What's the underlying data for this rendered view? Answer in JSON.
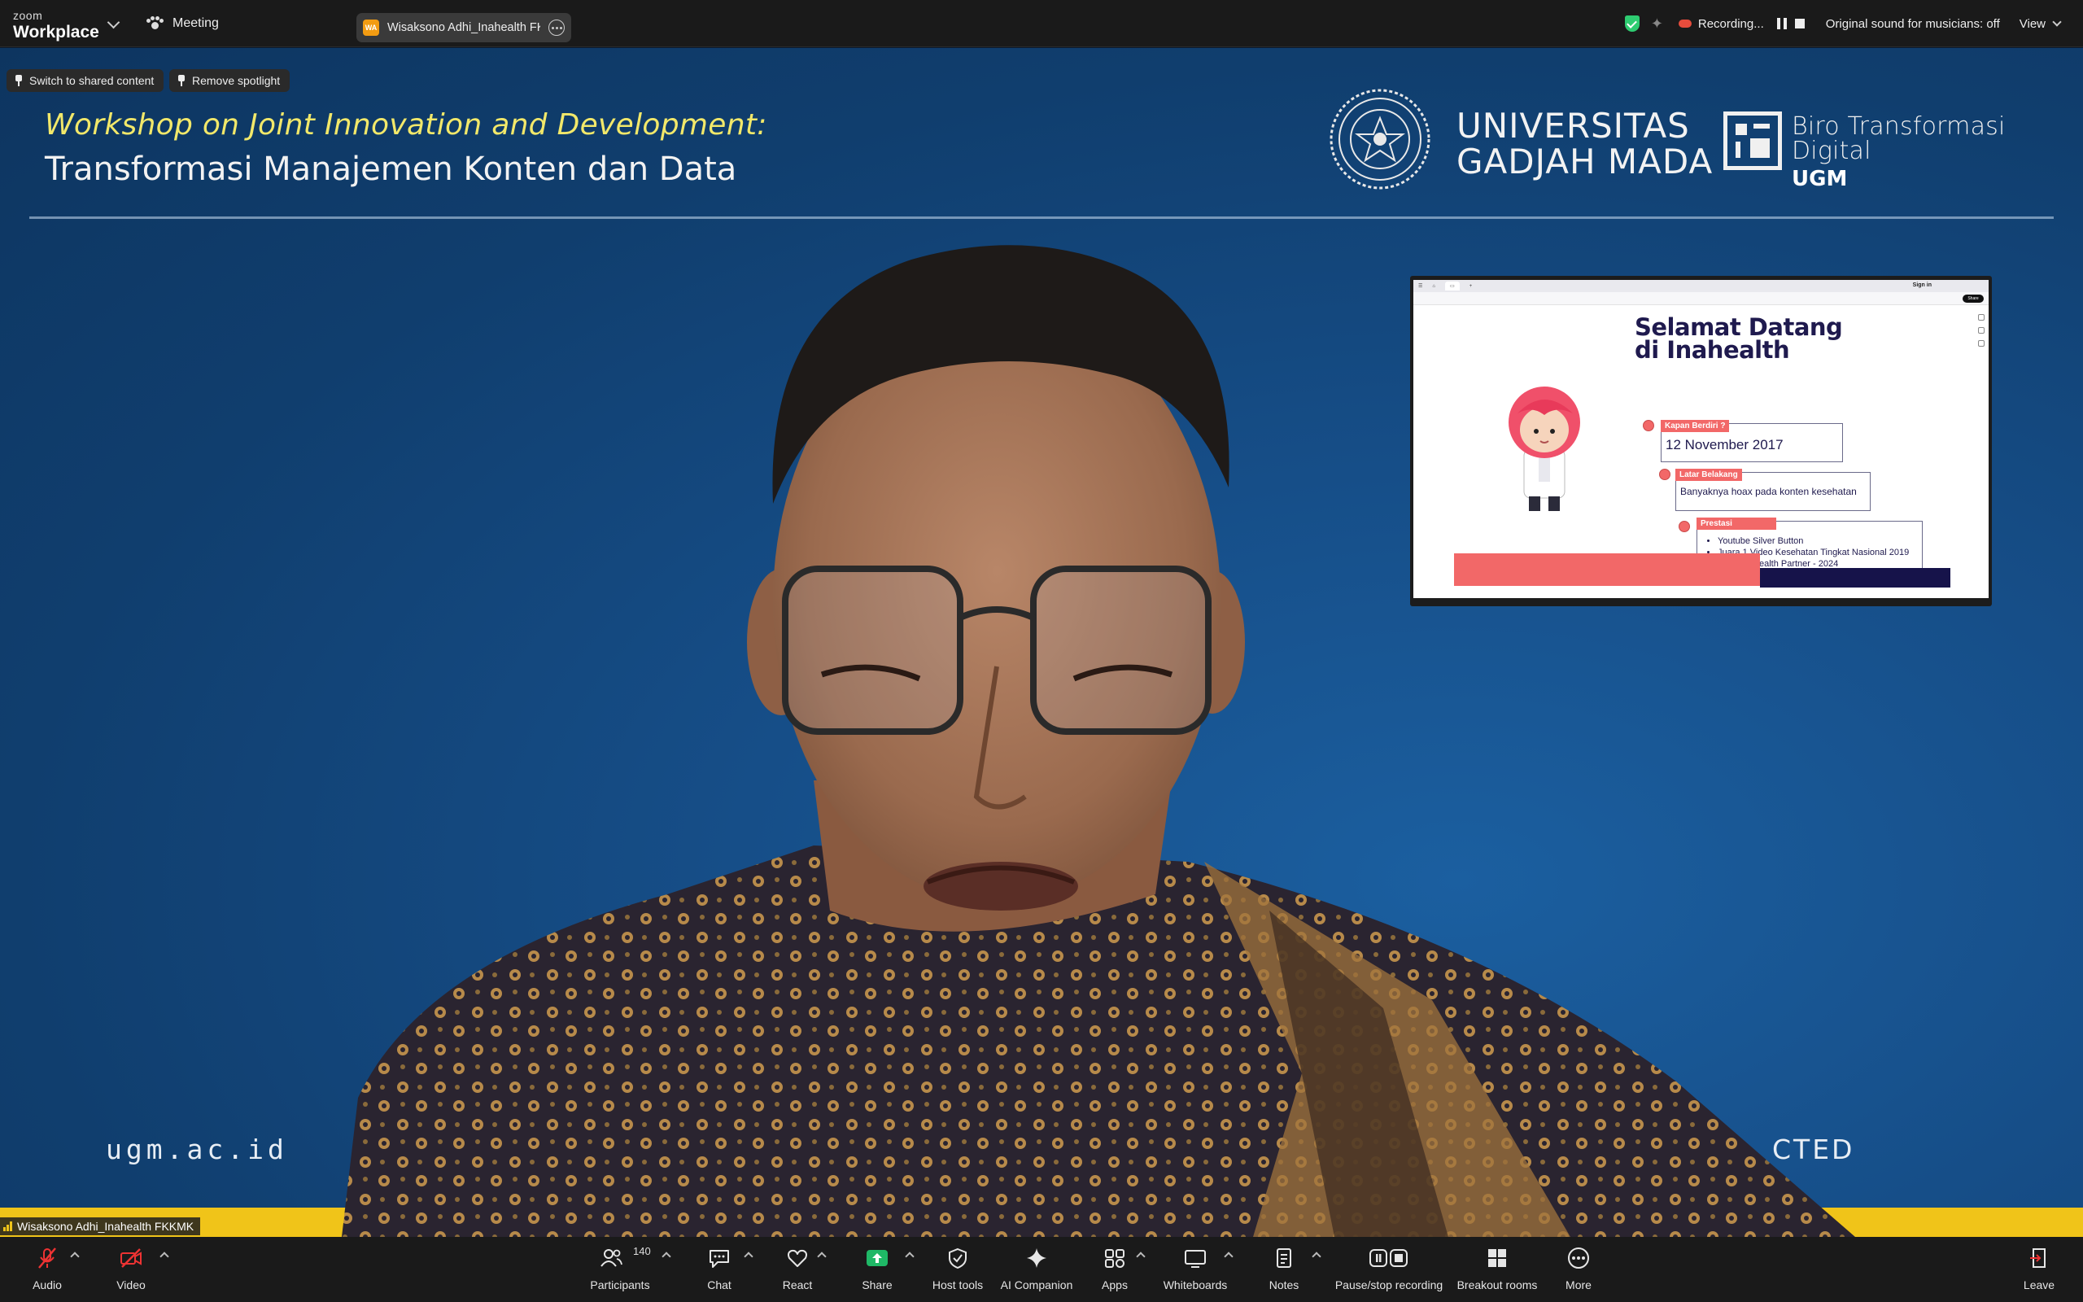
{
  "app": {
    "logo_top": "zoom",
    "logo_bottom": "Workplace",
    "meeting_label": "Meeting",
    "tab_avatar_initials": "WA",
    "tab_name": "Wisaksono Adhi_Inahealth FKKMK",
    "recording_label": "Recording...",
    "original_sound": "Original sound for musicians: off",
    "view_label": "View",
    "accent_green": "#2ecc71",
    "accent_share": "#1fb866",
    "icons": [
      "chevron-down-icon",
      "paw-icon",
      "more-icon",
      "shield-check-icon",
      "sparkle-icon",
      "cloud-record-icon",
      "pause-icon",
      "stop-icon"
    ]
  },
  "stage": {
    "switch_content": "Switch to shared content",
    "remove_spotlight": "Remove spotlight",
    "background": {
      "workshop_line1": "Workshop on Joint Innovation and Development:",
      "workshop_line2": "Transformasi Manajemen Konten dan Data",
      "univ_line1": "UNIVERSITAS",
      "univ_line2": "GADJAH MADA",
      "biro_line1": "Biro Transformasi Digital",
      "biro_line2": "UGM",
      "url": "ugm.ac.id",
      "partial_word": "CTED"
    },
    "participant_name": "Wisaksono Adhi_Inahealth FKKMK"
  },
  "shared_slide": {
    "signin": "Sign in",
    "share": "Share",
    "title_line1": "Selamat Datang",
    "title_line2": "di Inahealth",
    "kapan_tag": "Kapan Berdiri ?",
    "kapan_value": "12 November 2017",
    "latar_tag": "Latar Belakang",
    "latar_value": "Banyaknya hoax pada konten kesehatan",
    "prestasi_tag": "Prestasi",
    "prestasi_items": [
      "Youtube Silver Button",
      "Juara 1 Video Kesehatan Tingkat Nasional 2019",
      "Youtube Health Partner - 2024"
    ],
    "accent_red": "#f26868",
    "accent_navy": "#1f1a4e"
  },
  "toolbar": {
    "audio": "Audio",
    "video": "Video",
    "participants": "Participants",
    "participants_count": "140",
    "chat": "Chat",
    "react": "React",
    "share": "Share",
    "host_tools": "Host tools",
    "ai_companion": "AI Companion",
    "apps": "Apps",
    "whiteboards": "Whiteboards",
    "notes": "Notes",
    "pause_stop_recording": "Pause/stop recording",
    "breakout_rooms": "Breakout rooms",
    "more": "More",
    "leave": "Leave"
  }
}
